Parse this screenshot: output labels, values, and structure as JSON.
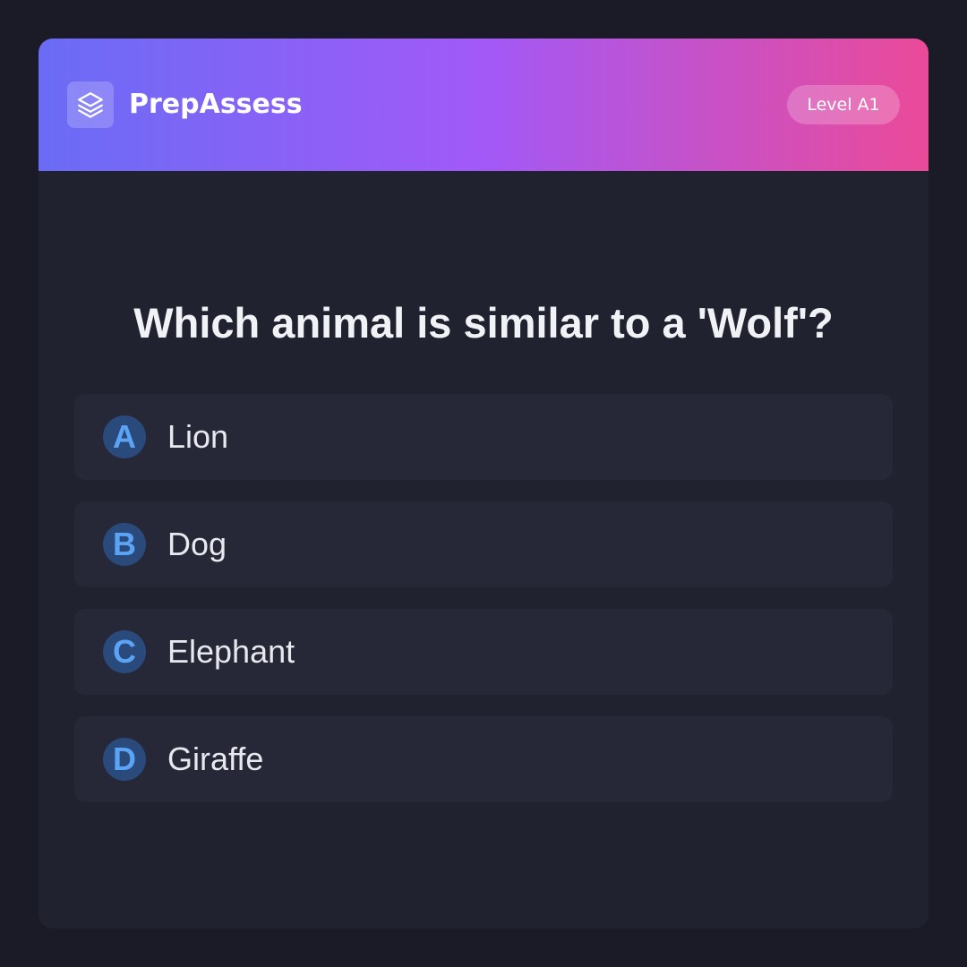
{
  "header": {
    "brand": "PrepAssess",
    "logo_icon": "layers-icon",
    "level_badge": "Level A1",
    "gradient_colors": [
      "#6a6cf6",
      "#a259f7",
      "#eb4a98"
    ]
  },
  "question": {
    "text": "Which animal is similar to a 'Wolf'?"
  },
  "options": [
    {
      "letter": "A",
      "label": "Lion"
    },
    {
      "letter": "B",
      "label": "Dog"
    },
    {
      "letter": "C",
      "label": "Elephant"
    },
    {
      "letter": "D",
      "label": "Giraffe"
    }
  ],
  "colors": {
    "background": "#1a1b26",
    "card": "#20222f",
    "option_bg": "#262837",
    "letter_circle": "#2a4a7c",
    "letter_text": "#5aa3f5"
  }
}
